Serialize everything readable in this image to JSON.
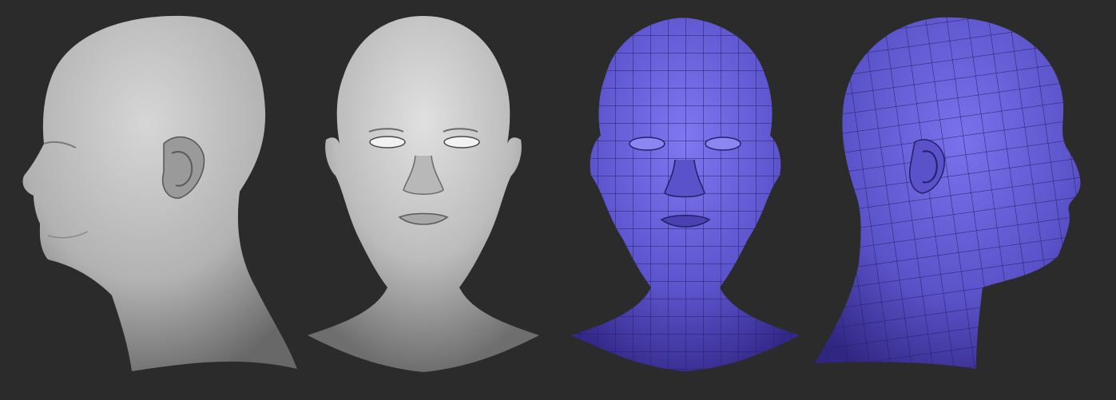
{
  "scene": {
    "background_color": "#2b2b2b",
    "clay_color": "#c8c8c8",
    "wire_fill_color": "#6a62d8",
    "wire_line_color": "#2a2470",
    "views": [
      {
        "id": "sculpt-side-left",
        "kind": "smooth-sculpt",
        "facing": "left"
      },
      {
        "id": "sculpt-front",
        "kind": "smooth-sculpt",
        "facing": "front"
      },
      {
        "id": "wireframe-front",
        "kind": "polygon-wireframe",
        "facing": "front"
      },
      {
        "id": "wireframe-side-right",
        "kind": "polygon-wireframe",
        "facing": "right"
      }
    ]
  }
}
